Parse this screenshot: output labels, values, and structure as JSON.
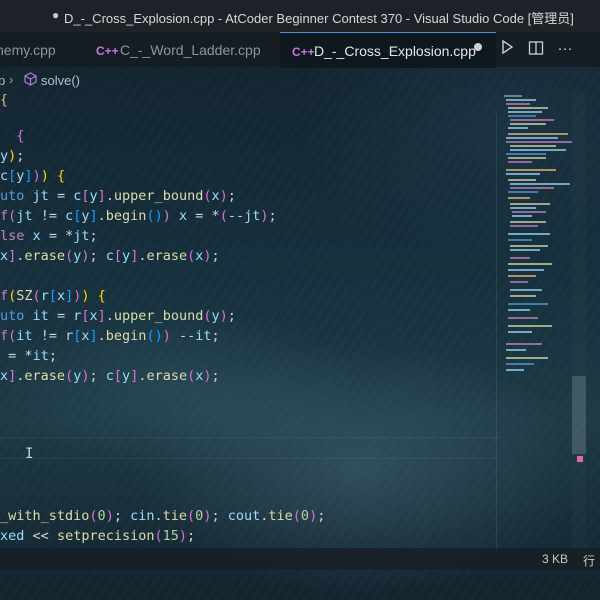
{
  "window": {
    "title": "D_-_Cross_Explosion.cpp - AtCoder Beginner Contest 370 - Visual Studio Code [管理员]"
  },
  "tabs": [
    {
      "label": "hemy.cpp",
      "active": false
    },
    {
      "label": "C_-_Word_Ladder.cpp",
      "active": false
    },
    {
      "label": "D_-_Cross_Explosion.cpp",
      "active": true,
      "unsaved": true
    }
  ],
  "tab_icon_text": "C++",
  "breadcrumb": {
    "items": [
      "p",
      "solve()"
    ]
  },
  "code": {
    "lines": [
      "  {",
      "y);",
      "c[y])) {",
      "uto jt = c[y].upper_bound(x);",
      "f(jt != c[y].begin()) x = *(--jt);",
      "lse x = *jt;",
      "x].erase(y); c[y].erase(x);",
      "",
      "f(SZ(r[x])) {",
      "uto it = r[x].upper_bound(y);",
      "f(it != r[x].begin()) --it;",
      " = *it;",
      "x].erase(y); c[y].erase(x);",
      "",
      "",
      "",
      "",
      "",
      "",
      "_with_stdio(0); cin.tie(0); cout.tie(0);",
      "xed << setprecision(15);"
    ]
  },
  "status": {
    "file_size": "3 KB",
    "cursor_label": "行"
  }
}
